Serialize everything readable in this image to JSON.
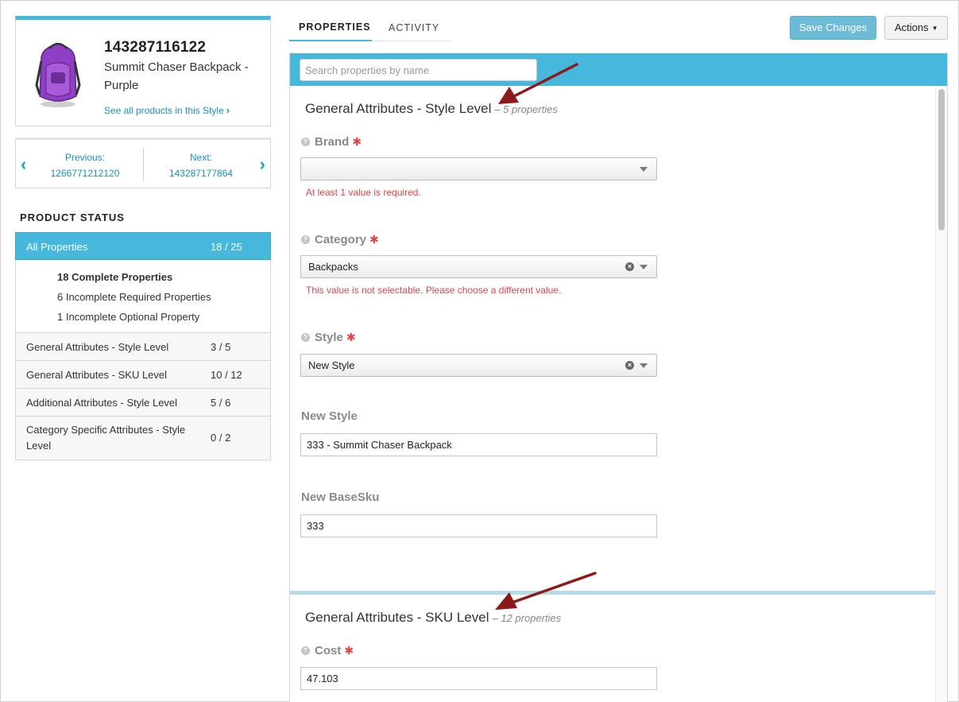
{
  "product": {
    "id": "143287116122",
    "name": "Summit Chaser Backpack - Purple",
    "style_link": "See all products in this Style"
  },
  "pager": {
    "previous_label": "Previous:",
    "previous_value": "1266771212120",
    "next_label": "Next:",
    "next_value": "143287177864"
  },
  "status": {
    "heading": "PRODUCT STATUS",
    "active": {
      "label": "All Properties",
      "count": "18 / 25"
    },
    "summary": [
      "18 Complete Properties",
      "6 Incomplete Required Properties",
      "1 Incomplete Optional Property"
    ],
    "rows": [
      {
        "label": "General Attributes - Style Level",
        "count": "3 / 5"
      },
      {
        "label": "General Attributes - SKU Level",
        "count": "10 / 12"
      },
      {
        "label": "Additional Attributes - Style Level",
        "count": "5 / 6"
      },
      {
        "label": "Category Specific Attributes - Style Level",
        "count": "0 / 2"
      }
    ]
  },
  "tabs": {
    "properties": "PROPERTIES",
    "activity": "ACTIVITY"
  },
  "toolbar": {
    "save": "Save Changes",
    "actions": "Actions"
  },
  "search": {
    "placeholder": "Search properties by name",
    "value": ""
  },
  "sections": [
    {
      "title": "General Attributes - Style Level",
      "meta": "– 5 properties"
    },
    {
      "title": "General Attributes - SKU Level",
      "meta": "– 12 properties"
    }
  ],
  "fields": {
    "brand": {
      "label": "Brand",
      "value": "",
      "error": "At least 1 value is required."
    },
    "category": {
      "label": "Category",
      "value": "Backpacks",
      "error": "This value is not selectable. Please choose a different value."
    },
    "style": {
      "label": "Style",
      "value": "New Style"
    },
    "new_style": {
      "label": "New Style",
      "value": "333 - Summit Chaser Backpack"
    },
    "new_basesku": {
      "label": "New BaseSku",
      "value": "333"
    },
    "cost": {
      "label": "Cost",
      "value": "47.103"
    }
  },
  "colors": {
    "accent": "#45b8dc",
    "link": "#1a8fbf",
    "error": "#e04545",
    "annotation_arrow": "#8b1a1a",
    "product_purple": "#8e3fc4"
  },
  "icons": [
    "chevron-right-icon",
    "chevron-left-icon",
    "help-icon",
    "required-asterisk-icon",
    "clear-icon",
    "dropdown-caret-icon",
    "caret-down-icon"
  ]
}
